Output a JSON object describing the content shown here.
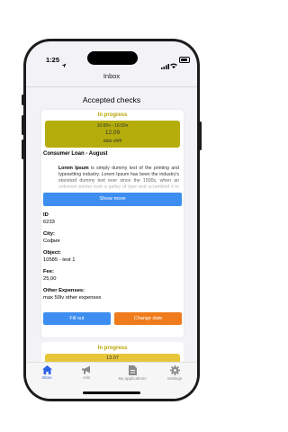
{
  "status_bar": {
    "time": "1:25"
  },
  "header": {
    "title": "Inbox"
  },
  "page": {
    "title": "Accepted checks"
  },
  "card": {
    "status": "In progress",
    "date_line1": "10:00ч - 16:00ч",
    "date_main": "12.09",
    "date_line3": "date shift",
    "loan_title": "Consumer Loan - August",
    "desc_bold": "Lorem Ipsum",
    "desc_text": " is simply dummy text of the printing and typesetting industry. Lorem Ipsum has been the industry's standard dummy text ever since the 1500s, when an unknown printer took a galley of type and scrambled it to make a type specimen book.",
    "show_more": "Show more",
    "fields": [
      {
        "label": "ID",
        "value": "6233"
      },
      {
        "label": "City:",
        "value": "София"
      },
      {
        "label": "Object:",
        "value": "10585 - test 1"
      },
      {
        "label": "Fee:",
        "value": "25,00"
      },
      {
        "label": "Other Expenses:",
        "value": "max 50lv other expenses"
      }
    ],
    "fill_out": "Fill out",
    "change_date": "Change date"
  },
  "next_card": {
    "status": "In progress",
    "date": "13.07"
  },
  "tabs": [
    {
      "label": "Inbox",
      "icon": "home-icon",
      "active": true
    },
    {
      "label": "Ads",
      "icon": "megaphone-icon",
      "active": false
    },
    {
      "label": "My applications",
      "icon": "document-icon",
      "active": false
    },
    {
      "label": "Settings",
      "icon": "gear-icon",
      "active": false
    }
  ],
  "colors": {
    "accent": "#3d8ef0",
    "warning": "#f07b1c",
    "status_olive": "#b5ad0b",
    "status_yellow": "#e8c63a",
    "tab_active": "#2e63e8"
  }
}
